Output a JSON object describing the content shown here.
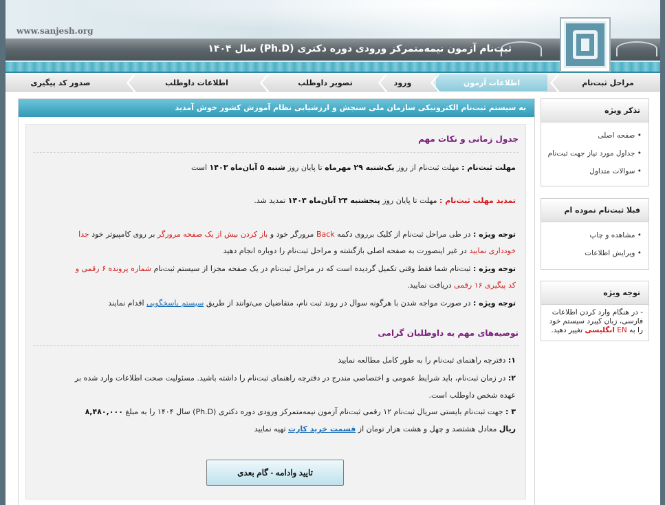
{
  "header": {
    "site_url": "www.sanjesh.org",
    "title": "ثبت‌نام آزمون نیمه‌متمرکز ورودی دوره دکتری (Ph.D) سال ۱۴۰۴"
  },
  "nav": {
    "items": [
      {
        "label": "مراحل ثبت‌نام"
      },
      {
        "label": "اطلاعات آزمون"
      },
      {
        "label": "ورود"
      },
      {
        "label": "تصویر داوطلب"
      },
      {
        "label": "اطلاعات داوطلب"
      },
      {
        "label": "صدور کد پیگیری"
      }
    ]
  },
  "main": {
    "welcome": "به سیستم ثبت‌نام الکترونیکی سازمان ملی سنجش و ارزشیابی نظام آموزش کشور خوش آمدید",
    "schedule_title": "جدول زمانی و نکات مهم",
    "deadline_label": "مهلت ثبت‌نام :",
    "deadline_a": "مهلت ثبت‌نام از روز",
    "deadline_start": "یک‌شنبه ۲۹ مهرماه",
    "deadline_b": "تا پایان روز",
    "deadline_end": "شنبه ۵ آبان‌ماه ۱۴۰۳",
    "deadline_c": "است",
    "ext_label": "تمدید مهلت ثبت‌نام :",
    "ext_a": "مهلت تا پایان روز",
    "ext_date": "پنجشنبه ۲۴ آبان‌ماه ۱۴۰۳",
    "ext_c": "تمدید شد.",
    "note_label": "توجه ویژه :",
    "note1_a": "در طی مراحل ثبت‌نام از کلیک برروی دکمه",
    "note1_back": "Back",
    "note1_b": "مرورگر خود و",
    "note1_red1": "باز کردن بیش از یک صفحه مرورگر",
    "note1_c": "بر روی کامپیوتر خود",
    "note1_red2": "جدا",
    "note1_red3": "خودداری نمایید",
    "note1_d": "در غیر اینصورت به صفحه اصلی بازگشته و مراحل ثبت‌نام را دوباره انجام دهید",
    "note2_a": "ثبت‌نام شما فقط وقتی تکمیل گردیده است که در مراحل ثبت‌نام در یک صفحه مجزا از سیستم ثبت‌نام",
    "note2_red1": "شماره پرونده ۶ رقمی و",
    "note2_red2": "کد پیگیری ۱۶ رقمی",
    "note2_b": "دریافت نمایید.",
    "note3_a": "در صورت مواجه شدن با هرگونه سوال در روند ثبت نام، متقاضیان می‌توانند از طریق",
    "note3_link": "سیستم پاسخگویی",
    "note3_b": "اقدام نمایند",
    "rec_title": "توصیه‌های مهم به داوطلبان گرامی",
    "rec1_num": "۱:",
    "rec1": "دفترچه راهنمای ثبت‌نام را به طور کامل مطالعه نمایید",
    "rec2_num": "۲:",
    "rec2_a": "در زمان ثبت‌نام، باید شرایط عمومی و اختصاصی مندرج در دفترچه راهنمای ثبت‌نام را داشته باشید. مسئولیت صحت اطلاعات وارد شده بر",
    "rec2_b": "عهده شخص داوطلب است.",
    "rec3_num": "۳ :",
    "rec3_a": "جهت ثبت‌نام بایستی سریال ثبت‌نام ۱۲ رقمی ثبت‌نام آزمون نیمه‌متمرکز ورودی دوره دکتری (Ph.D) سال ۱۴۰۴ را به مبلغ",
    "rec3_amount": "۸,۴۸۰,۰۰۰",
    "rec3_rial": "ریال",
    "rec3_b": "معادل هشتصد و چهل و هشت هزار تومان از",
    "rec3_link": "قسمت خرید کارت",
    "rec3_c": "تهیه نمایید",
    "continue_button": "تایید وادامه - گام بعدی"
  },
  "sidebar": {
    "box1_title": "تذکر ویژه",
    "box1_items": [
      {
        "label": "صفحه اصلی"
      },
      {
        "label": "جداول مورد نیاز جهت ثبت‌نام"
      },
      {
        "label": "سوالات متداول"
      }
    ],
    "box2_title": "قبلا ثبت‌نام نموده ام",
    "box2_items": [
      {
        "label": "مشاهده و چاپ"
      },
      {
        "label": "ویرایش اطلاعات"
      }
    ],
    "box3_title": "توجه ویژه",
    "box3_a": "- در هنگام وارد کردن اطلاعات فارسی، زبان کیبرد سیستم خود را به",
    "box3_en": "EN",
    "box3_red": "انگلیسی",
    "box3_b": "تغییر دهید."
  }
}
